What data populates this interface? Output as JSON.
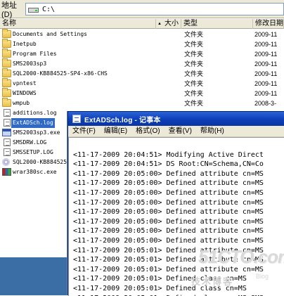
{
  "address_bar": {
    "label": "地址(D)",
    "path": "C:\\"
  },
  "columns": {
    "name": "名称",
    "size": "大小",
    "type": "类型",
    "date": "修改日期"
  },
  "files": [
    {
      "name": "Documents and Settings",
      "type": "文件夹",
      "date": "2009-11",
      "icon": "folder-icon"
    },
    {
      "name": "Inetpub",
      "type": "文件夹",
      "date": "2009-11",
      "icon": "folder-icon"
    },
    {
      "name": "Program Files",
      "type": "文件夹",
      "date": "2009-11",
      "icon": "folder-icon"
    },
    {
      "name": "SMS2003sp3",
      "type": "文件夹",
      "date": "2009-11",
      "icon": "folder-icon"
    },
    {
      "name": "SQL2000-KB884525-SP4-x86-CHS",
      "type": "文件夹",
      "date": "2009-11",
      "icon": "folder-icon"
    },
    {
      "name": "vpntest",
      "type": "文件夹",
      "date": "2009-11",
      "icon": "folder-icon"
    },
    {
      "name": "WINDOWS",
      "type": "文件夹",
      "date": "2009-11",
      "icon": "folder-icon"
    },
    {
      "name": "wmpub",
      "type": "文件夹",
      "date": "2008-3-",
      "icon": "folder-icon"
    },
    {
      "name": "additions.log",
      "type": "",
      "date": "",
      "icon": "document-icon"
    },
    {
      "name": "ExtADSch.log",
      "type": "",
      "date": "",
      "icon": "document-icon",
      "selected": true
    },
    {
      "name": "SMS2003sp3.exe",
      "type": "",
      "date": "",
      "icon": "installer-icon"
    },
    {
      "name": "SMSDRW.LOG",
      "type": "",
      "date": "",
      "icon": "document-icon"
    },
    {
      "name": "SMSSETUP.LOG",
      "type": "",
      "date": "",
      "icon": "document-icon"
    },
    {
      "name": "SQL2000-KB884525",
      "type": "",
      "date": "",
      "icon": "disc-image-icon"
    },
    {
      "name": "wrar380sc.exe",
      "type": "",
      "date": "",
      "icon": "winrar-icon"
    }
  ],
  "notepad": {
    "title": "ExtADSch.log - 记事本",
    "menu": [
      "文件(F)",
      "编辑(E)",
      "格式(O)",
      "查看(V)",
      "帮助(H)"
    ],
    "lines": [
      "",
      "<11-17-2009 20:04:51> Modifying Active Direct",
      "<11-17-2009 20:04:51> DS Root:CN=Schema,CN=Co",
      "<11-17-2009 20:05:00> Defined attribute cn=MS",
      "<11-17-2009 20:05:00> Defined attribute cn=MS",
      "<11-17-2009 20:05:00> Defined attribute cn=MS",
      "<11-17-2009 20:05:00> Defined attribute cn=MS",
      "<11-17-2009 20:05:00> Defined attribute cn=MS",
      "<11-17-2009 20:05:00> Defined attribute cn=MS",
      "<11-17-2009 20:05:00> Defined attribute cn=MS",
      "<11-17-2009 20:05:00> Defined attribute cn=MS",
      "<11-17-2009 20:05:01> Defined attribute cn=MS",
      "<11-17-2009 20:05:01> Defined attribute cn=MS",
      "<11-17-2009 20:05:01> Defined attribute cn=MS",
      "<11-17-2009 20:05:01> Defined class cn=MS",
      "<11-17-2009 20:05:01> Defined class cn=MS",
      "<11-17-2009 20:05:01> Defined class cn=MS-SMS"
    ]
  },
  "watermark": {
    "logo": "51CTO.com",
    "subtitle": "技术博客",
    "blog": "Blog"
  }
}
